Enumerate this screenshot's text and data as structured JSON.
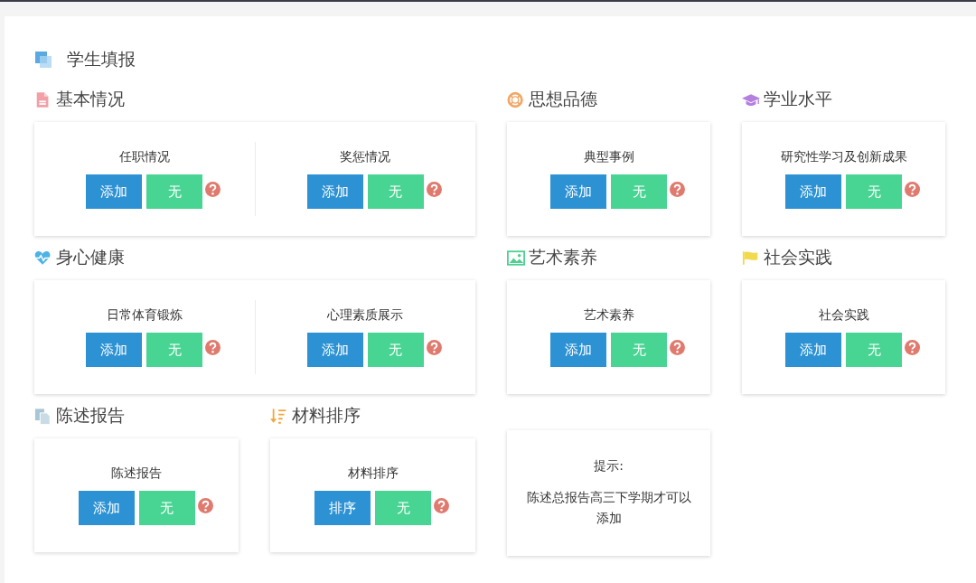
{
  "page_title": {
    "text": "学生填报"
  },
  "sections": [
    {
      "kind": "items",
      "title": "基本情况",
      "items": [
        {
          "label": "任职情况",
          "buttons": [
            {
              "label": "添加",
              "kind": "primary"
            },
            {
              "label": "无",
              "kind": "success"
            }
          ]
        },
        {
          "label": "奖惩情况",
          "buttons": [
            {
              "label": "添加",
              "kind": "primary"
            },
            {
              "label": "无",
              "kind": "success"
            }
          ]
        }
      ]
    },
    {
      "kind": "items",
      "title": "思想品德",
      "items": [
        {
          "label": "典型事例",
          "buttons": [
            {
              "label": "添加",
              "kind": "primary"
            },
            {
              "label": "无",
              "kind": "success"
            }
          ]
        }
      ]
    },
    {
      "kind": "items",
      "title": "学业水平",
      "items": [
        {
          "label": "研究性学习及创新成果",
          "buttons": [
            {
              "label": "添加",
              "kind": "primary"
            },
            {
              "label": "无",
              "kind": "success"
            }
          ]
        }
      ]
    },
    {
      "kind": "items",
      "title": "身心健康",
      "items": [
        {
          "label": "日常体育锻炼",
          "buttons": [
            {
              "label": "添加",
              "kind": "primary"
            },
            {
              "label": "无",
              "kind": "success"
            }
          ]
        },
        {
          "label": "心理素质展示",
          "buttons": [
            {
              "label": "添加",
              "kind": "primary"
            },
            {
              "label": "无",
              "kind": "success"
            }
          ]
        }
      ]
    },
    {
      "kind": "items",
      "title": "艺术素养",
      "items": [
        {
          "label": "艺术素养",
          "buttons": [
            {
              "label": "添加",
              "kind": "primary"
            },
            {
              "label": "无",
              "kind": "success"
            }
          ]
        }
      ]
    },
    {
      "kind": "items",
      "title": "社会实践",
      "items": [
        {
          "label": "社会实践",
          "buttons": [
            {
              "label": "添加",
              "kind": "primary"
            },
            {
              "label": "无",
              "kind": "success"
            }
          ]
        }
      ]
    },
    {
      "kind": "items",
      "title": "陈述报告",
      "items": [
        {
          "label": "陈述报告",
          "buttons": [
            {
              "label": "添加",
              "kind": "primary"
            },
            {
              "label": "无",
              "kind": "success"
            }
          ]
        }
      ]
    },
    {
      "kind": "items",
      "title": "材料排序",
      "items": [
        {
          "label": "材料排序",
          "buttons": [
            {
              "label": "排序",
              "kind": "primary"
            },
            {
              "label": "无",
              "kind": "success"
            }
          ]
        }
      ]
    },
    {
      "kind": "note",
      "heading": "提示:",
      "text": "陈述总报告高三下学期才可以添加"
    }
  ]
}
